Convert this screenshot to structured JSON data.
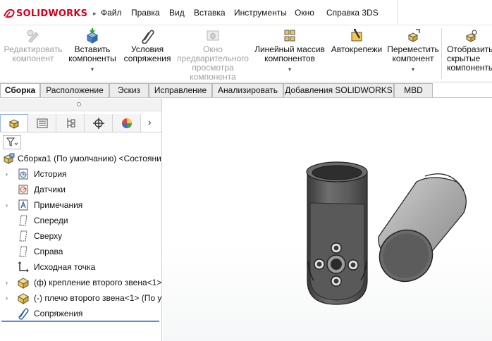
{
  "app": {
    "logo_ds": "DS",
    "logo_solid": "SOLID",
    "logo_works": "WORKS",
    "logo_caret": "▸"
  },
  "menu": {
    "items": [
      "Файл",
      "Правка",
      "Вид",
      "Вставка",
      "Инструменты",
      "Окно",
      "Справка 3DS"
    ]
  },
  "commands": [
    {
      "label": "Редактировать\nкомпонент",
      "enabled": false,
      "dropdown": false,
      "icon": "edit-component-icon"
    },
    {
      "label": "Вставить\nкомпоненты",
      "enabled": true,
      "dropdown": true,
      "icon": "insert-components-icon"
    },
    {
      "label": "Условия\nсопряжения",
      "enabled": true,
      "dropdown": false,
      "icon": "mate-icon"
    },
    {
      "label": "Окно\nпредварительного\nпросмотра\nкомпонента",
      "enabled": false,
      "dropdown": false,
      "icon": "component-preview-icon"
    },
    {
      "label": "Линейный массив\nкомпонентов",
      "enabled": true,
      "dropdown": true,
      "icon": "linear-pattern-icon"
    },
    {
      "label": "Автокрепежи",
      "enabled": true,
      "dropdown": false,
      "icon": "smart-fasteners-icon"
    },
    {
      "label": "Переместить\nкомпонент",
      "enabled": true,
      "dropdown": true,
      "icon": "move-component-icon"
    },
    {
      "label": "Отобразить\nскрытые\nкомпоненты",
      "enabled": true,
      "dropdown": false,
      "icon": "show-hidden-icon"
    }
  ],
  "dropdown_glyph": "▾",
  "tabs": [
    {
      "label": "Сборка",
      "active": true
    },
    {
      "label": "Расположение",
      "active": false
    },
    {
      "label": "Эскиз",
      "active": false
    },
    {
      "label": "Исправление",
      "active": false
    },
    {
      "label": "Анализировать",
      "active": false
    },
    {
      "label": "Добавления SOLIDWORKS",
      "active": false
    },
    {
      "label": "MBD",
      "active": false
    }
  ],
  "panel": {
    "tab_icons": [
      "feature-manager-icon",
      "property-manager-icon",
      "configuration-manager-icon",
      "dimxpert-icon",
      "display-manager-icon"
    ],
    "more_glyph": "›",
    "filter_icon": "filter-icon"
  },
  "tree": [
    {
      "label": "Сборка1 (По умолчанию) <Состояни",
      "icon": "assembly-icon",
      "expand": false,
      "indent": 0
    },
    {
      "label": "История",
      "icon": "history-icon",
      "expand": true,
      "indent": 1
    },
    {
      "label": "Датчики",
      "icon": "sensor-icon",
      "expand": false,
      "indent": 1
    },
    {
      "label": "Примечания",
      "icon": "annotations-icon",
      "expand": true,
      "indent": 1
    },
    {
      "label": "Спереди",
      "icon": "plane-icon",
      "expand": false,
      "indent": 1
    },
    {
      "label": "Сверху",
      "icon": "plane-icon",
      "expand": false,
      "indent": 1
    },
    {
      "label": "Справа",
      "icon": "plane-icon",
      "expand": false,
      "indent": 1
    },
    {
      "label": "Исходная точка",
      "icon": "origin-icon",
      "expand": false,
      "indent": 1
    },
    {
      "label": "(ф) крепление второго звена<1>",
      "icon": "part-icon",
      "expand": true,
      "indent": 1
    },
    {
      "label": "(-) плечо второго звена<1> (По у",
      "icon": "part-icon",
      "expand": true,
      "indent": 1
    },
    {
      "label": "Сопряжения",
      "icon": "mates-folder-icon",
      "expand": false,
      "indent": 1
    }
  ],
  "expand_glyph": "›",
  "colors": {
    "logo_red": "#d1001c",
    "part_yellow": "#f2c94c",
    "selection_blue": "#5b8fd0"
  }
}
